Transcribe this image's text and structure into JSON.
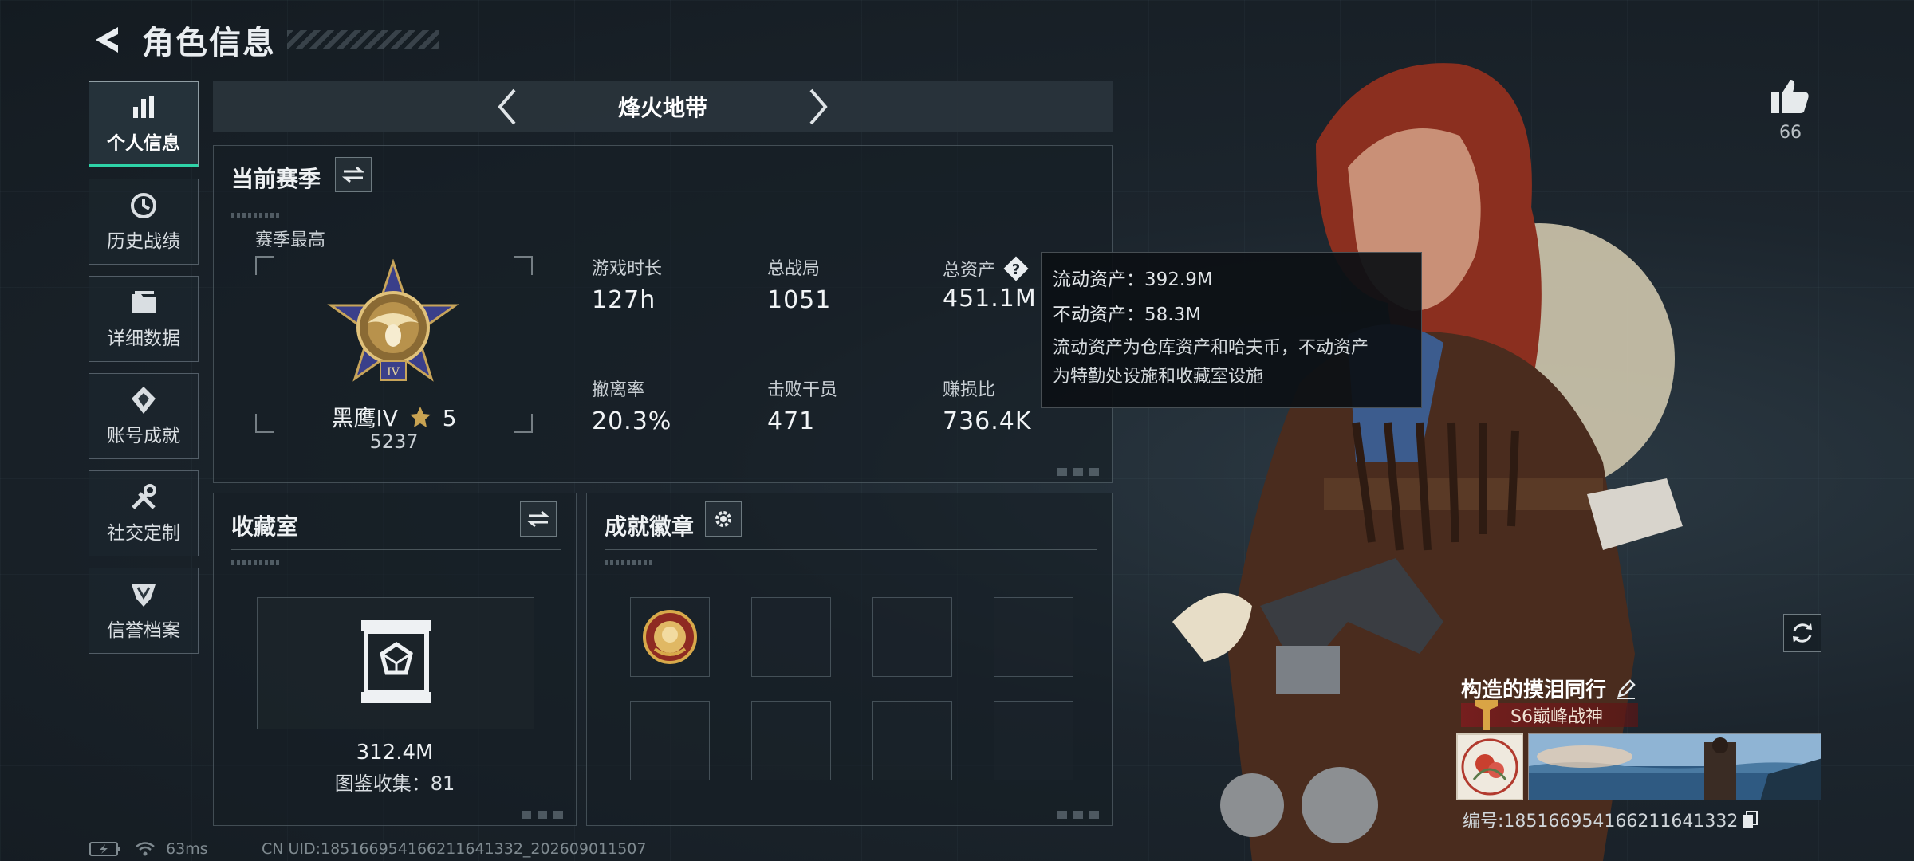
{
  "header": {
    "title": "角色信息"
  },
  "sidebar": {
    "items": [
      {
        "label": "个人信息",
        "icon": "bar-chart-icon",
        "active": true
      },
      {
        "label": "历史战绩",
        "icon": "history-clock-icon"
      },
      {
        "label": "详细数据",
        "icon": "folder-icon"
      },
      {
        "label": "账号成就",
        "icon": "medal-icon"
      },
      {
        "label": "社交定制",
        "icon": "tools-icon"
      },
      {
        "label": "信誉档案",
        "icon": "shield-icon"
      }
    ]
  },
  "mode": {
    "title": "烽火地带"
  },
  "season": {
    "title": "当前赛季",
    "best_label": "赛季最高",
    "rank_name": "黑鹰IV",
    "rank_stars": "5",
    "rank_score": "5237",
    "stats": [
      {
        "label": "游戏时长",
        "value": "127h"
      },
      {
        "label": "总战局",
        "value": "1051"
      },
      {
        "label": "总资产",
        "value": "451.1M",
        "has_help": true
      },
      {
        "label": "撤离率",
        "value": "20.3%"
      },
      {
        "label": "击败干员",
        "value": "471"
      },
      {
        "label": "赚损比",
        "value": "736.4K"
      }
    ]
  },
  "tooltip": {
    "liquid": "流动资产：392.9M",
    "fixed": "不动资产：58.3M",
    "desc_line1": "流动资产为仓库资产和哈夫币，不动资产",
    "desc_line2": "为特勤处设施和收藏室设施"
  },
  "vault": {
    "title": "收藏室",
    "value": "312.4M",
    "collection": "图鉴收集：81"
  },
  "achievements": {
    "title": "成就徽章",
    "slots_filled": 1,
    "slots_total": 8
  },
  "player": {
    "likes": "66",
    "name": "构造的摸泪同行",
    "rank_title": "S6巅峰战神",
    "id_text": "编号:185166954166211641332"
  },
  "status": {
    "ping": "63ms",
    "uid": "CN UID:185166954166211641332_202609011507"
  },
  "colors": {
    "accent": "#2ed3a8",
    "rank_banner": "#7a1e1e",
    "background": "#1c252d"
  }
}
